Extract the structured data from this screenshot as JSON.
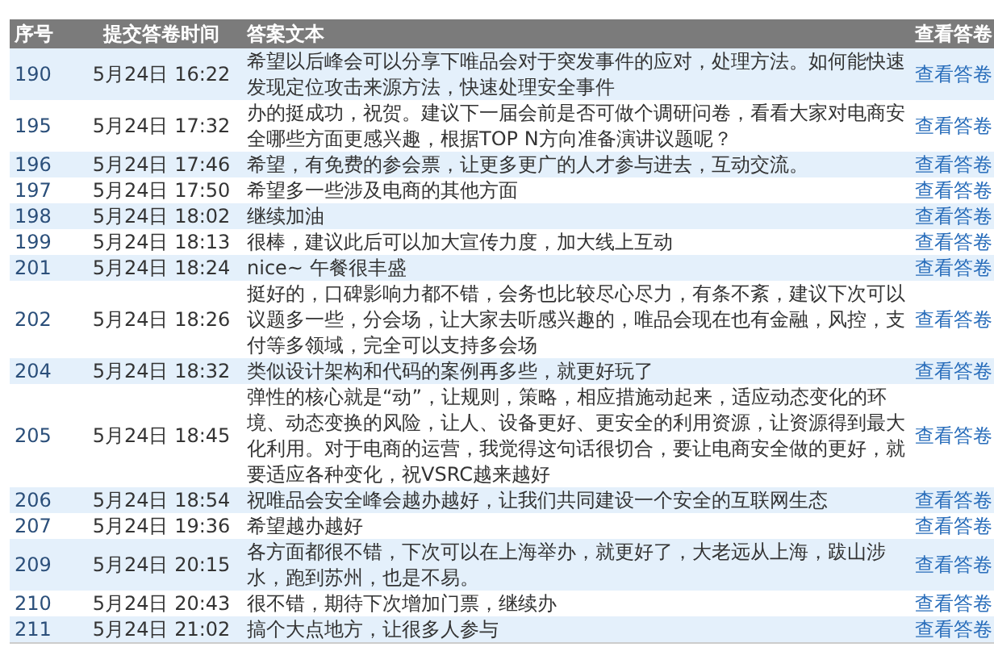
{
  "table": {
    "columns": [
      "序号",
      "提交答卷时间",
      "答案文本",
      "查看答卷"
    ],
    "rows": [
      {
        "id": "190",
        "time": "5月24日 16:22",
        "answer": "希望以后峰会可以分享下唯品会对于突发事件的应对，处理方法。如何能快速发现定位攻击来源方法，快速处理安全事件",
        "link": "查看答卷"
      },
      {
        "id": "195",
        "time": "5月24日 17:32",
        "answer": "办的挺成功，祝贺。建议下一届会前是否可做个调研问卷，看看大家对电商安全哪些方面更感兴趣，根据TOP N方向准备演讲议题呢？",
        "link": "查看答卷"
      },
      {
        "id": "196",
        "time": "5月24日 17:46",
        "answer": "希望，有免费的参会票，让更多更广的人才参与进去，互动交流。",
        "link": "查看答卷"
      },
      {
        "id": "197",
        "time": "5月24日 17:50",
        "answer": "希望多一些涉及电商的其他方面",
        "link": "查看答卷"
      },
      {
        "id": "198",
        "time": "5月24日 18:02",
        "answer": "继续加油",
        "link": "查看答卷"
      },
      {
        "id": "199",
        "time": "5月24日 18:13",
        "answer": "很棒，建议此后可以加大宣传力度，加大线上互动",
        "link": "查看答卷"
      },
      {
        "id": "201",
        "time": "5月24日 18:24",
        "answer": "nice~ 午餐很丰盛",
        "link": "查看答卷"
      },
      {
        "id": "202",
        "time": "5月24日 18:26",
        "answer": "挺好的，口碑影响力都不错，会务也比较尽心尽力，有条不紊，建议下次可以议题多一些，分会场，让大家去听感兴趣的，唯品会现在也有金融，风控，支付等多领域，完全可以支持多会场",
        "link": "查看答卷"
      },
      {
        "id": "204",
        "time": "5月24日 18:32",
        "answer": "类似设计架构和代码的案例再多些，就更好玩了",
        "link": "查看答卷"
      },
      {
        "id": "205",
        "time": "5月24日 18:45",
        "answer": "弹性的核心就是“动”，让规则，策略，相应措施动起来，适应动态变化的环境、动态变换的风险，让人、设备更好、更安全的利用资源，让资源得到最大化利用。对于电商的运营，我觉得这句话很切合，要让电商安全做的更好，就要适应各种变化，祝VSRC越来越好",
        "link": "查看答卷"
      },
      {
        "id": "206",
        "time": "5月24日 18:54",
        "answer": "祝唯品会安全峰会越办越好，让我们共同建设一个安全的互联网生态",
        "link": "查看答卷"
      },
      {
        "id": "207",
        "time": "5月24日 19:36",
        "answer": "希望越办越好",
        "link": "查看答卷"
      },
      {
        "id": "209",
        "time": "5月24日 20:15",
        "answer": "各方面都很不错，下次可以在上海举办，就更好了，大老远从上海，跋山涉水，跑到苏州，也是不易。",
        "link": "查看答卷"
      },
      {
        "id": "210",
        "time": "5月24日 20:43",
        "answer": "很不错，期待下次增加门票，继续办",
        "link": "查看答卷"
      },
      {
        "id": "211",
        "time": "5月24日 21:02",
        "answer": "搞个大点地方，让很多人参与",
        "link": "查看答卷"
      }
    ]
  }
}
